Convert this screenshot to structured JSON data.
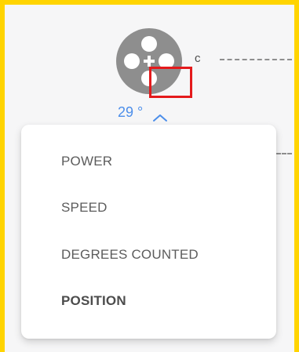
{
  "port": {
    "letter": "c",
    "icon": "motor-port-icon"
  },
  "selector": {
    "value": "29",
    "unit": "°",
    "toggle_icon": "chevron-up-icon"
  },
  "menu": {
    "items": [
      {
        "label": "POWER",
        "selected": false
      },
      {
        "label": "SPEED",
        "selected": false
      },
      {
        "label": "DEGREES COUNTED",
        "selected": false
      },
      {
        "label": "POSITION",
        "selected": true
      }
    ]
  },
  "colors": {
    "frame": "#FFD400",
    "accent": "#4C8EEA",
    "highlight": "#E41A1C",
    "icon": "#8E8E8E"
  }
}
